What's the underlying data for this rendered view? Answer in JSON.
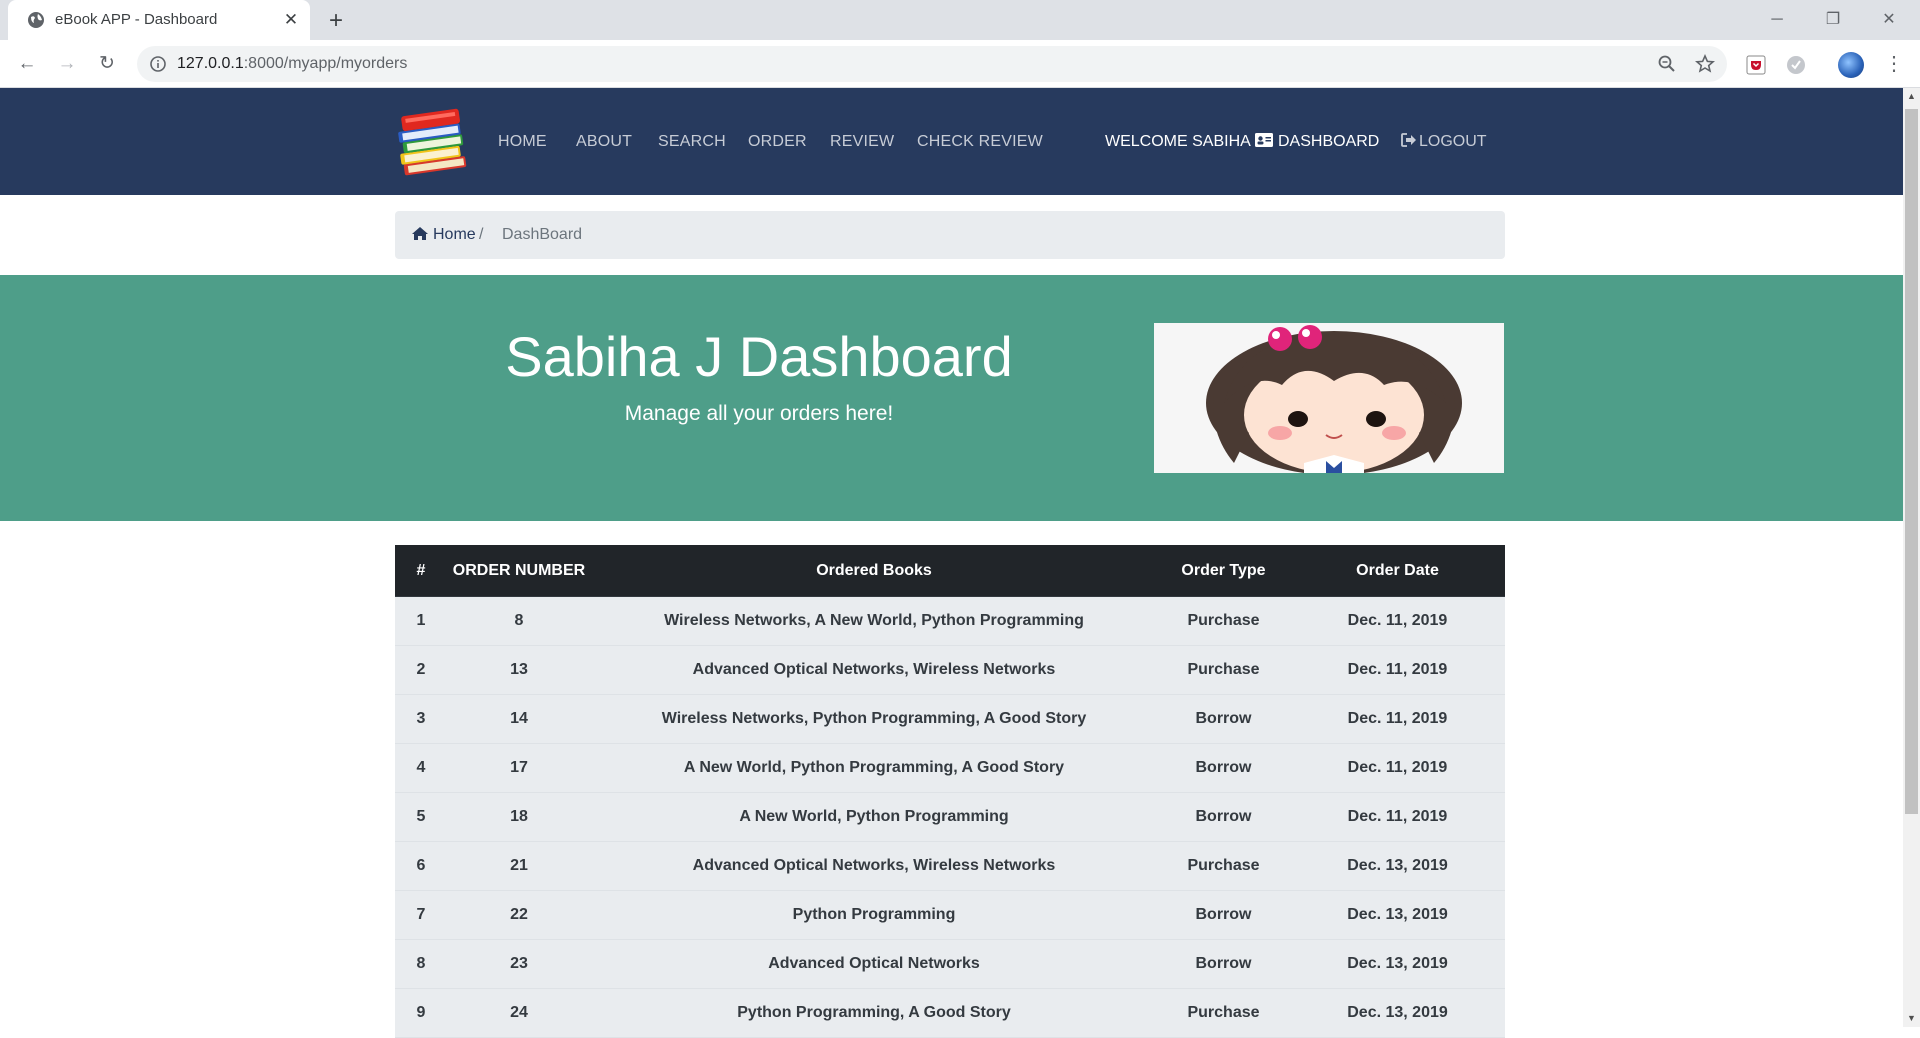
{
  "browser": {
    "tab_title": "eBook APP - Dashboard",
    "url_host": "127.0.0.1",
    "url_path": ":8000/myapp/myorders",
    "new_tab_icon": "plus-icon",
    "window_controls": [
      "minimize-icon",
      "restore-icon",
      "close-icon"
    ]
  },
  "navbar": {
    "links": [
      "HOME",
      "ABOUT",
      "SEARCH",
      "ORDER",
      "REVIEW",
      "CHECK REVIEW"
    ],
    "welcome": "WELCOME SABIHA",
    "dashboard": "DASHBOARD",
    "logout": "LOGOUT",
    "bg_color": "#273a5e"
  },
  "breadcrumb": {
    "home": "Home",
    "separator": "/",
    "current": "DashBoard"
  },
  "hero": {
    "title": "Sabiha J Dashboard",
    "subtitle": "Manage all your orders here!",
    "bg_color": "#4e9e89"
  },
  "orders": {
    "headers": [
      "#",
      "ORDER NUMBER",
      "Ordered Books",
      "Order Type",
      "Order Date"
    ],
    "rows": [
      [
        "1",
        "8",
        "Wireless Networks, A New World, Python Programming",
        "Purchase",
        "Dec. 11, 2019"
      ],
      [
        "2",
        "13",
        "Advanced Optical Networks, Wireless Networks",
        "Purchase",
        "Dec. 11, 2019"
      ],
      [
        "3",
        "14",
        "Wireless Networks, Python Programming, A Good Story",
        "Borrow",
        "Dec. 11, 2019"
      ],
      [
        "4",
        "17",
        "A New World, Python Programming, A Good Story",
        "Borrow",
        "Dec. 11, 2019"
      ],
      [
        "5",
        "18",
        "A New World, Python Programming",
        "Borrow",
        "Dec. 11, 2019"
      ],
      [
        "6",
        "21",
        "Advanced Optical Networks, Wireless Networks",
        "Purchase",
        "Dec. 13, 2019"
      ],
      [
        "7",
        "22",
        "Python Programming",
        "Borrow",
        "Dec. 13, 2019"
      ],
      [
        "8",
        "23",
        "Advanced Optical Networks",
        "Borrow",
        "Dec. 13, 2019"
      ],
      [
        "9",
        "24",
        "Python Programming, A Good Story",
        "Purchase",
        "Dec. 13, 2019"
      ]
    ]
  }
}
